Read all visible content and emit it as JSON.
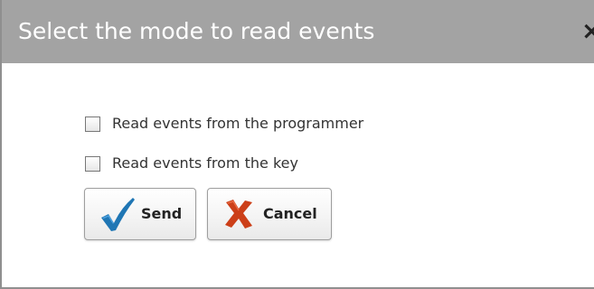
{
  "dialog": {
    "title": "Select the mode to read events",
    "close_icon": "close-icon",
    "options": [
      {
        "label": "Read events from the programmer",
        "checked": false
      },
      {
        "label": "Read events from the key",
        "checked": false
      }
    ],
    "buttons": {
      "send": {
        "label": "Send",
        "icon": "checkmark-icon"
      },
      "cancel": {
        "label": "Cancel",
        "icon": "x-mark-icon"
      }
    }
  },
  "colors": {
    "title_bar": "#a3a3a3",
    "title_text": "#ffffff",
    "send_icon": "#1f76b4",
    "cancel_icon": "#cc3f18"
  }
}
